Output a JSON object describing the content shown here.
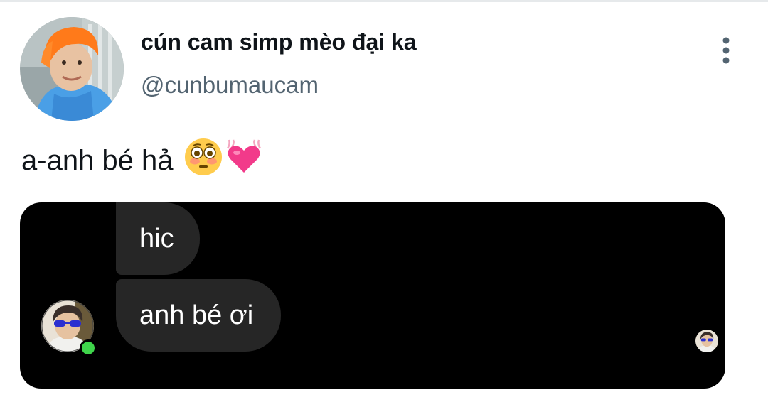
{
  "tweet": {
    "author": {
      "display_name": "cún cam simp mèo đại ka",
      "handle": "@cunbumaucam",
      "avatar_icon": "profile-photo-orange-hair"
    },
    "text": "a-anh bé hả",
    "emojis": [
      "flushed-face",
      "vibrating-heart"
    ],
    "more_icon": "vertical-ellipsis-icon"
  },
  "chat": {
    "background": "#000000",
    "bubble_color": "#262626",
    "messages": [
      {
        "text": "hic"
      },
      {
        "text": "anh bé ơi"
      }
    ],
    "sender_avatar": "profile-photo-sunglasses",
    "online_status_color": "#3fd44b",
    "seen_avatar": "profile-photo-sunglasses-small"
  },
  "colors": {
    "text_primary": "#0f1419",
    "text_secondary": "#536471"
  }
}
